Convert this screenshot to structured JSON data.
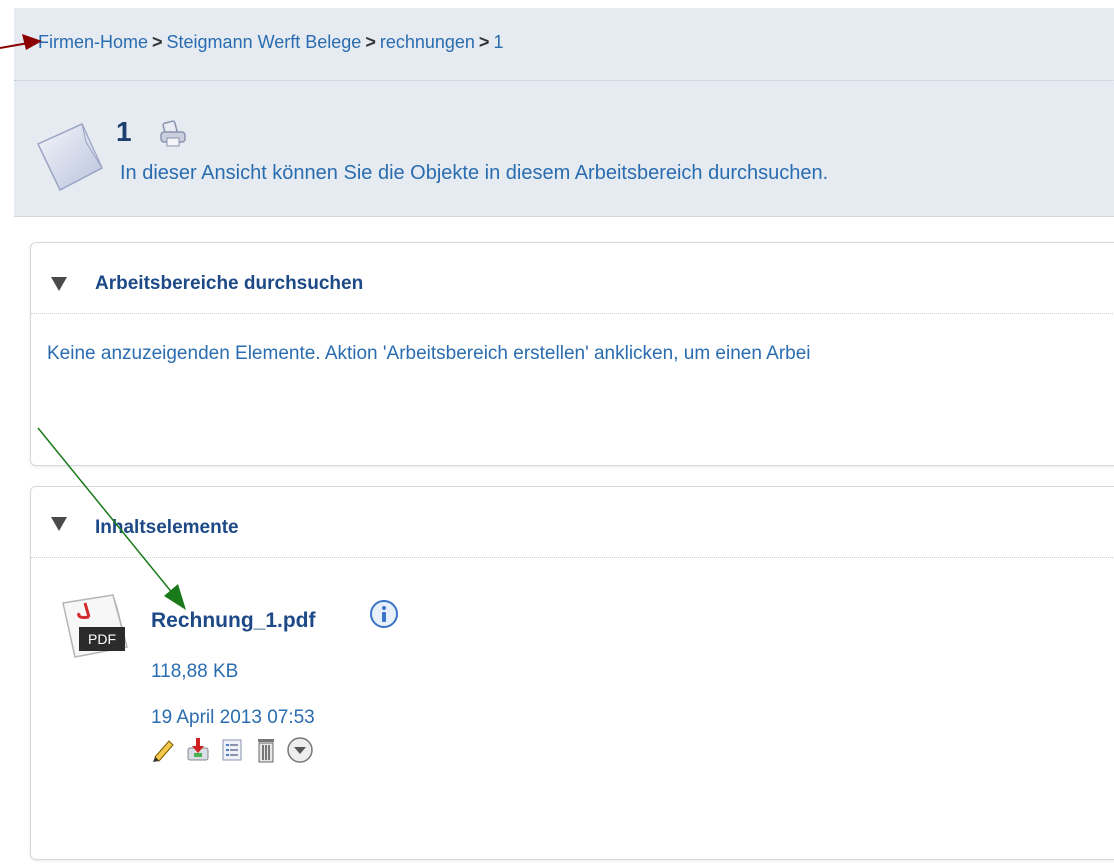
{
  "breadcrumb": {
    "items": [
      "Firmen-Home",
      "Steigmann Werft Belege",
      "rechnungen",
      "1"
    ],
    "separator": ">"
  },
  "header": {
    "title": "1",
    "description": "In dieser Ansicht können Sie die Objekte in diesem Arbeitsbereich durchsuchen."
  },
  "panels": {
    "workspaces": {
      "title": "Arbeitsbereiche durchsuchen",
      "empty_message": "Keine anzuzeigenden Elemente. Aktion 'Arbeitsbereich erstellen' anklicken, um einen Arbei"
    },
    "contents": {
      "title": "Inhaltselemente",
      "file": {
        "name": "Rechnung_1.pdf",
        "size": "118,88 KB",
        "date": "19 April 2013 07:53",
        "icon": "pdf-icon",
        "icon_label": "PDF"
      },
      "actions": [
        "edit-pencil-icon",
        "download-icon",
        "properties-list-icon",
        "delete-trash-icon",
        "more-dropdown-icon"
      ]
    }
  },
  "colors": {
    "link": "#2a6cb0",
    "title": "#1d4a87",
    "header_bg": "#e5ebf1",
    "arrow_red": "#8b0000",
    "arrow_green": "#1a7a1a"
  }
}
